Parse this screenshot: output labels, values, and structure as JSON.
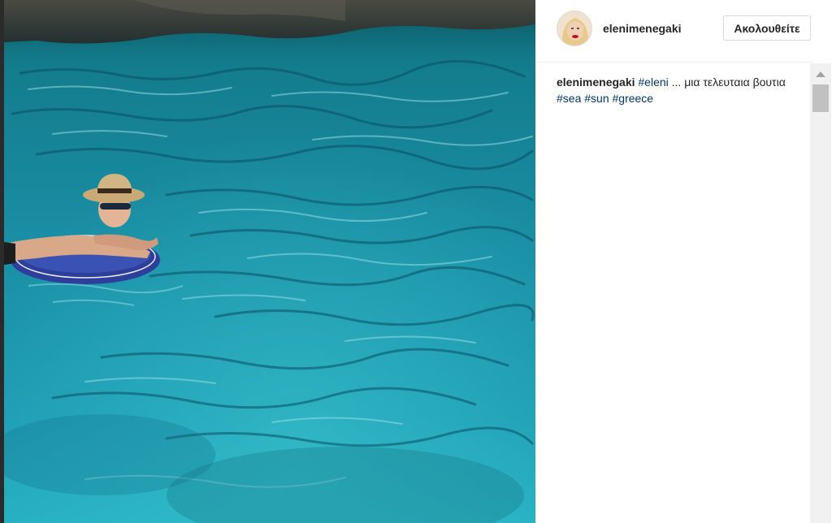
{
  "post": {
    "username": "elenimenegaki",
    "follow_label": "Ακολουθείτε"
  },
  "photo": {
    "subject": "woman in straw hat and sunglasses on inflatable ring in turquoise sea",
    "colors": {
      "water_light": "#2fa3b4",
      "water_dark": "#0f6d82",
      "rock": "#3a3a33",
      "float_ring": "#2d3f9a"
    }
  },
  "caption": {
    "user": "elenimenegaki",
    "tag1": "#eleni",
    "text1": "... μια τελευταια βουτια",
    "tag2": "#sea",
    "tag3": "#sun",
    "tag4": "#greece"
  },
  "colors": {
    "hashtag": "#003569",
    "border": "#dbdbdb"
  },
  "icons": [
    "scroll-up-arrow-icon"
  ]
}
